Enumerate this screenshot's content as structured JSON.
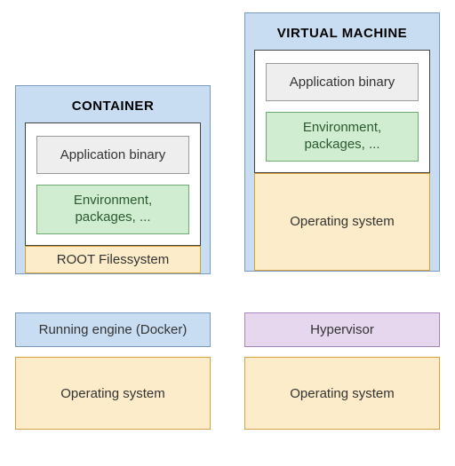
{
  "left": {
    "title": "CONTAINER",
    "app": "Application binary",
    "env": "Environment,\npackages, ...",
    "rootfs": "ROOT Filessystem",
    "engine": "Running engine (Docker)",
    "os": "Operating system"
  },
  "right": {
    "title": "VIRTUAL MACHINE",
    "app": "Application binary",
    "env": "Environment,\npackages, ...",
    "guest_os": "Operating system",
    "hypervisor": "Hypervisor",
    "os": "Operating system"
  }
}
